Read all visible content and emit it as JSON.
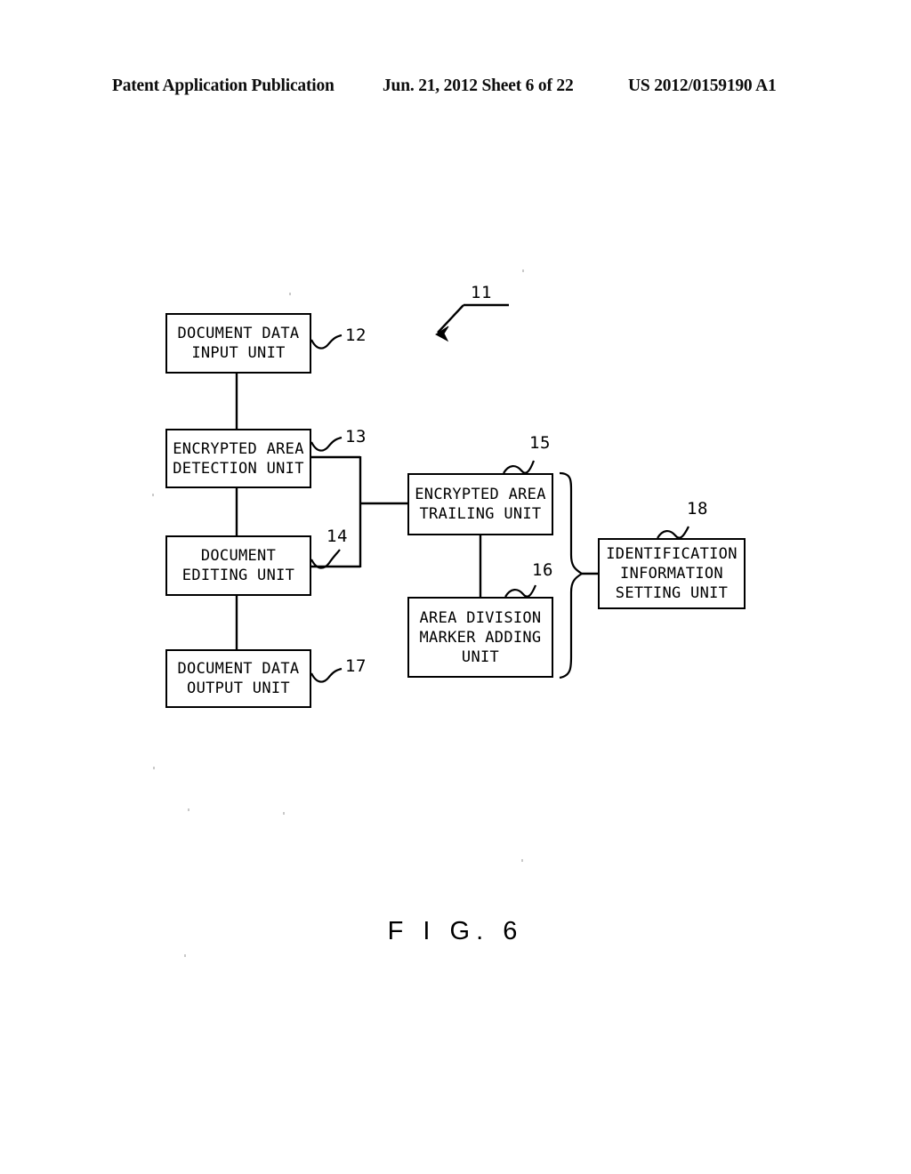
{
  "header": {
    "publication": "Patent Application Publication",
    "date_sheet": "Jun. 21, 2012  Sheet 6 of 22",
    "pub_number": "US 2012/0159190 A1"
  },
  "figure": {
    "caption": "F I G.  6",
    "system_numeral": "11",
    "boxes": [
      {
        "id": "12",
        "label": "DOCUMENT DATA\nINPUT UNIT",
        "numeral": "12"
      },
      {
        "id": "13",
        "label": "ENCRYPTED AREA\nDETECTION UNIT",
        "numeral": "13"
      },
      {
        "id": "14",
        "label": "DOCUMENT\nEDITING UNIT",
        "numeral": "14"
      },
      {
        "id": "17",
        "label": "DOCUMENT DATA\nOUTPUT UNIT",
        "numeral": "17"
      },
      {
        "id": "15",
        "label": "ENCRYPTED AREA\nTRAILING UNIT",
        "numeral": "15"
      },
      {
        "id": "16",
        "label": "AREA DIVISION\nMARKER ADDING\nUNIT",
        "numeral": "16"
      },
      {
        "id": "18",
        "label": "IDENTIFICATION\nINFORMATION\nSETTING UNIT",
        "numeral": "18"
      }
    ]
  },
  "colors": {
    "ink": "#000000",
    "paper": "#ffffff"
  }
}
